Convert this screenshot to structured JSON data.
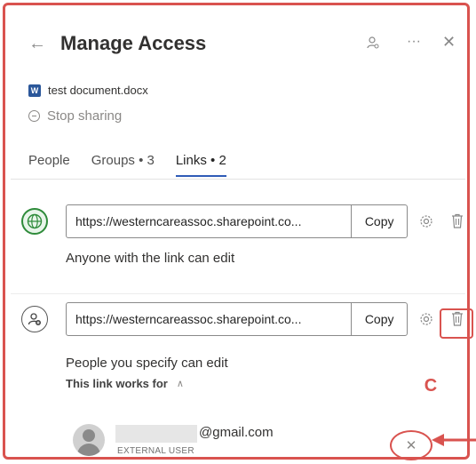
{
  "header": {
    "title": "Manage Access"
  },
  "file": {
    "name": "test document.docx",
    "stop_sharing": "Stop sharing"
  },
  "tabs": [
    {
      "label": "People",
      "active": false
    },
    {
      "label": "Groups • 3",
      "active": false
    },
    {
      "label": "Links • 2",
      "active": true
    }
  ],
  "links": [
    {
      "icon": "globe-icon",
      "url": "https://westerncareassoc.sharepoint.co...",
      "copy_label": "Copy",
      "permission": "Anyone with the link can edit"
    },
    {
      "icon": "specific-people-icon",
      "url": "https://westerncareassoc.sharepoint.co...",
      "copy_label": "Copy",
      "permission": "People you specify can edit",
      "works_for_label": "This link works for"
    }
  ],
  "user": {
    "email_suffix": "@gmail.com",
    "type": "EXTERNAL USER"
  },
  "annotation": {
    "label": "C"
  },
  "colors": {
    "accent": "#2f5bb7",
    "annotation_red": "#d9534f",
    "globe_green": "#2e8b3a"
  }
}
